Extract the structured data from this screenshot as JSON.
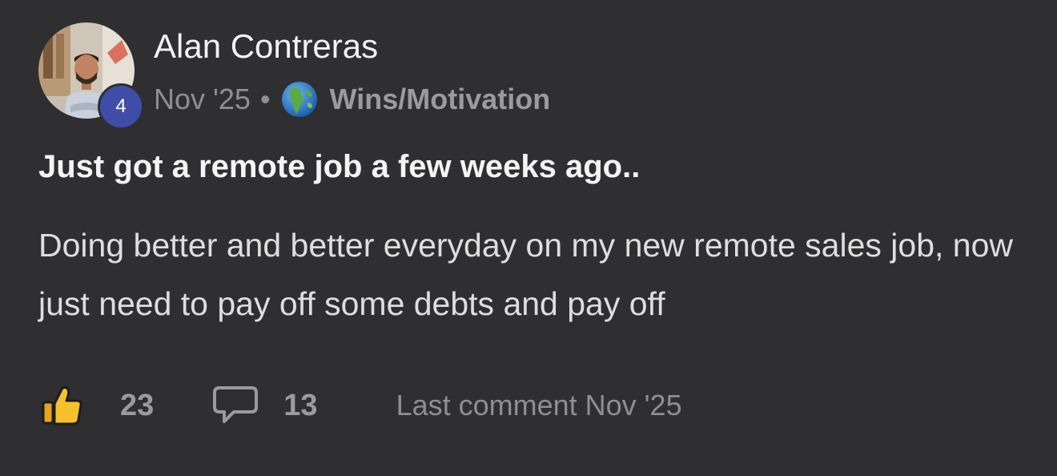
{
  "post": {
    "author": {
      "name": "Alan Contreras",
      "level": "4",
      "avatar_icon": "person-photo-avatar"
    },
    "meta": {
      "date": "Nov '25",
      "separator": "•",
      "category_icon": "globe-icon",
      "category": "Wins/Motivation"
    },
    "title": "Just got a remote job a few weeks ago..",
    "body": "Doing better and better everyday on my new remote sales job, now just need to pay off some debts and pay off",
    "actions": {
      "like_icon": "thumbs-up-icon",
      "like_count": "23",
      "comment_icon": "speech-bubble-icon",
      "comment_count": "13",
      "last_comment": "Last comment Nov '25"
    }
  },
  "colors": {
    "background": "#2f2f31",
    "level_badge": "#3f4da8",
    "muted_text": "#8f8f93",
    "primary_text": "#f2f2f2"
  }
}
